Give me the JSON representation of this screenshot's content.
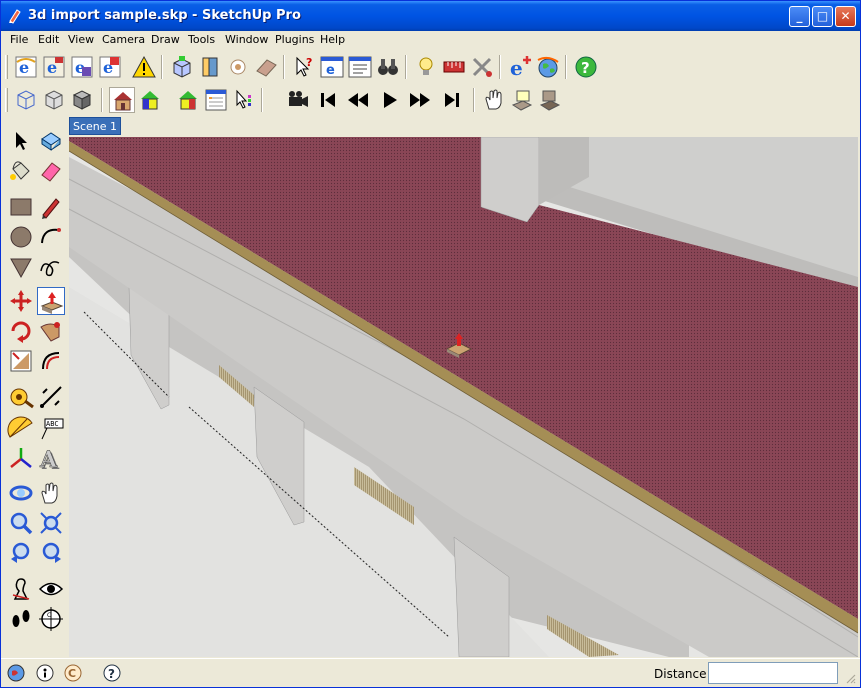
{
  "window": {
    "title": "3d import sample.skp - SketchUp Pro",
    "minimize_label": "_",
    "maximize_label": "□",
    "close_label": "✕"
  },
  "menu": [
    "File",
    "Edit",
    "View",
    "Camera",
    "Draw",
    "Tools",
    "Window",
    "Plugins",
    "Help"
  ],
  "toolbar1": {
    "icons": [
      "ie-icon",
      "ie-icon",
      "ie-icon",
      "ie-icon",
      "warning-icon",
      "component-box-icon",
      "component-push-icon",
      "camera-position-icon",
      "face-icon",
      "whats-this-icon",
      "ie-window-icon",
      "ie-list-icon",
      "binoculars-icon",
      "lightbulb-icon",
      "scale-icon",
      "tools-icon",
      "ie-export-icon",
      "globe-icon",
      "help-icon"
    ]
  },
  "toolbar2": {
    "icons": [
      "wireframe-icon",
      "hidden-line-icon",
      "shaded-icon",
      "house-icon",
      "house-color-icon",
      "house-shade-icon",
      "outliner-icon",
      "layers-icon",
      "movie-camera-icon",
      "first-frame-icon",
      "rewind-icon",
      "play-icon",
      "fast-forward-icon",
      "last-frame-icon",
      "hand-sandbox-icon",
      "stamp-icon",
      "drape-icon"
    ]
  },
  "scene_tab": {
    "label": "Scene 1"
  },
  "palette": {
    "tools": [
      "select-icon",
      "make-component-icon",
      "paint-bucket-icon",
      "eraser-icon",
      "rectangle-icon",
      "pencil-icon",
      "circle-icon",
      "arc-icon",
      "polygon-icon",
      "freehand-icon",
      "move-icon",
      "push-pull-icon",
      "rotate-icon",
      "follow-me-icon",
      "scale-tool-icon",
      "offset-icon",
      "tape-measure-icon",
      "dimension-icon",
      "protractor-icon",
      "text-label-icon",
      "axes-icon",
      "3d-text-icon",
      "orbit-icon",
      "pan-icon",
      "zoom-icon",
      "zoom-extents-icon",
      "previous-view-icon",
      "next-view-icon",
      "walk-icon",
      "look-around-icon",
      "footprints-icon",
      "section-plane-icon"
    ]
  },
  "status": {
    "icons": [
      "geo-location-icon",
      "credits-icon",
      "copyright-icon",
      "instructor-help-icon"
    ],
    "distance_label": "Distance",
    "distance_value": ""
  },
  "colors": {
    "roof": "#8a4656",
    "wall": "#c9c8c6",
    "ground": "#e6e6e4",
    "trim": "#a58e55",
    "selection": "#316ac5"
  }
}
